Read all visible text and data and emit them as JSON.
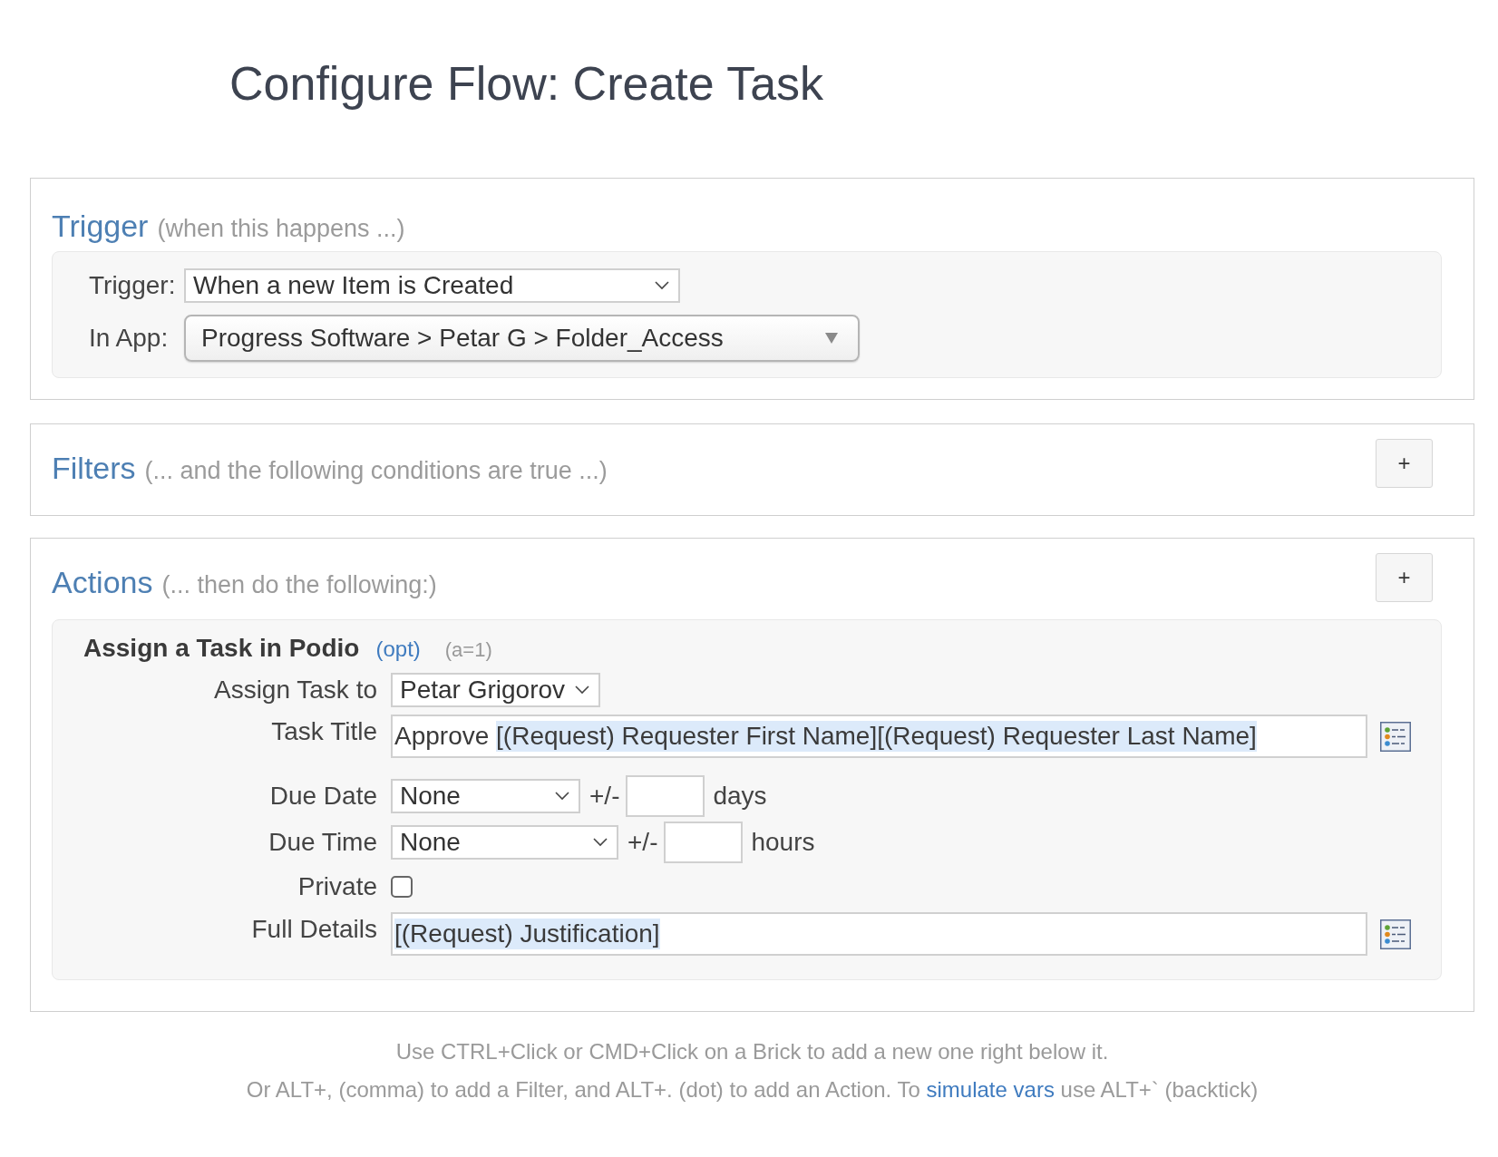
{
  "page": {
    "title": "Configure Flow: Create Task"
  },
  "trigger_section": {
    "heading": "Trigger",
    "subheading": "(when this happens ...)",
    "fields": [
      {
        "kind": "select",
        "label": "Trigger:",
        "value": "When a new Item is Created"
      },
      {
        "kind": "app_picker",
        "label": "In App:",
        "value": "Progress Software > Petar G > Folder_Access"
      }
    ]
  },
  "filters_section": {
    "heading": "Filters",
    "subheading": "(... and the following conditions are true ...)",
    "add_button": "+"
  },
  "actions_section": {
    "heading": "Actions",
    "subheading": "(... then do the following:)",
    "add_button": "+",
    "action": {
      "title": "Assign a Task in Podio",
      "option_link": "(opt)",
      "index_label": "(a=1)",
      "fields": [
        {
          "kind": "select",
          "label": "Assign Task to",
          "value": "Petar Grigorov"
        },
        {
          "kind": "variable_text",
          "label": "Task Title",
          "segments": [
            {
              "kind": "plain",
              "text": "Approve "
            },
            {
              "kind": "variable",
              "text": "[(Request) Requester First Name]"
            },
            {
              "kind": "variable",
              "text": "[(Request) Requester Last Name]"
            }
          ]
        },
        {
          "kind": "offset",
          "label": "Due Date",
          "value": "None",
          "sign": "+/-",
          "unit": "days"
        },
        {
          "kind": "offset",
          "label": "Due Time",
          "value": "None",
          "sign": "+/-",
          "unit": "hours"
        },
        {
          "kind": "checkbox",
          "label": "Private",
          "checked": false
        },
        {
          "kind": "variable_text",
          "label": "Full Details",
          "segments": [
            {
              "kind": "variable",
              "text": "[(Request) Justification]"
            }
          ]
        }
      ]
    }
  },
  "footer": {
    "hint": "Use CTRL+Click or CMD+Click on a Brick to add a new one right below it.",
    "shortcuts": {
      "before": "Or ALT+, (comma) to add a Filter, and ALT+. (dot) to add an Action. To ",
      "link": "simulate vars",
      "after": " use ALT+` (backtick)"
    }
  }
}
